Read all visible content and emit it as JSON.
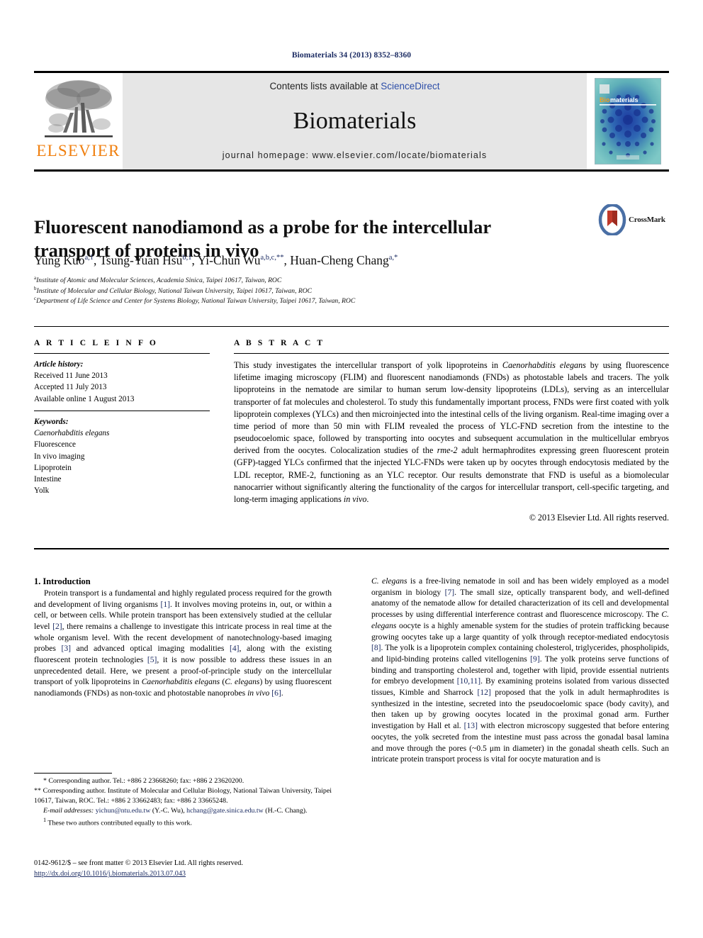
{
  "running_head": "Biomaterials 34 (2013) 8352–8360",
  "masthead": {
    "contents_prefix": "Contents lists available at ",
    "sciencedirect": "ScienceDirect",
    "journal_name": "Biomaterials",
    "homepage": "journal homepage: www.elsevier.com/locate/biomaterials",
    "publisher_logo_text": "ELSEVIER",
    "cover_title_bio": "Bio",
    "cover_title_materials": "materials",
    "colors": {
      "elsevier_orange": "#f08010",
      "sciencedirect_blue": "#2d4ea8",
      "band_gray": "#e6e6e6",
      "running_head_navy": "#1c2c63",
      "cover_teal": "#63b5b8",
      "cover_blue": "#1c3b9e"
    }
  },
  "article": {
    "title": "Fluorescent nanodiamond as a probe for the intercellular transport of proteins in vivo",
    "crossmark_label": "CrossMark",
    "authors": [
      {
        "name": "Yung Kuo",
        "marks": "a,1",
        "sep": ", "
      },
      {
        "name": "Tsung-Yuan Hsu",
        "marks": "b,1",
        "sep": ", "
      },
      {
        "name": "Yi-Chun Wu",
        "marks": "a,b,c,**",
        "sep": ", "
      },
      {
        "name": "Huan-Cheng Chang",
        "marks": "a,*",
        "sep": ""
      }
    ],
    "affiliations": [
      {
        "mark": "a",
        "text": "Institute of Atomic and Molecular Sciences, Academia Sinica, Taipei 10617, Taiwan, ROC"
      },
      {
        "mark": "b",
        "text": "Institute of Molecular and Cellular Biology, National Taiwan University, Taipei 10617, Taiwan, ROC"
      },
      {
        "mark": "c",
        "text": "Department of Life Science and Center for Systems Biology, National Taiwan University, Taipei 10617, Taiwan, ROC"
      }
    ]
  },
  "article_info": {
    "heading": "A R T I C L E   I N F O",
    "history_label": "Article history:",
    "history": [
      "Received 11 June 2013",
      "Accepted 11 July 2013",
      "Available online 1 August 2013"
    ],
    "keywords_label": "Keywords:",
    "keywords": [
      "Caenorhabditis elegans",
      "Fluorescence",
      "In vivo imaging",
      "Lipoprotein",
      "Intestine",
      "Yolk"
    ]
  },
  "abstract": {
    "heading": "A B S T R A C T",
    "paragraphs": [
      "This study investigates the intercellular transport of yolk lipoproteins in Caenorhabditis elegans by using fluorescence lifetime imaging microscopy (FLIM) and fluorescent nanodiamonds (FNDs) as photostable labels and tracers. The yolk lipoproteins in the nematode are similar to human serum low-density lipoproteins (LDLs), serving as an intercellular transporter of fat molecules and cholesterol. To study this fundamentally important process, FNDs were first coated with yolk lipoprotein complexes (YLCs) and then microinjected into the intestinal cells of the living organism. Real-time imaging over a time period of more than 50 min with FLIM revealed the process of YLC-FND secretion from the intestine to the pseudocoelomic space, followed by transporting into oocytes and subsequent accumulation in the multicellular embryos derived from the oocytes. Colocalization studies of the rme-2 adult hermaphrodites expressing green fluorescent protein (GFP)-tagged YLCs confirmed that the injected YLC-FNDs were taken up by oocytes through endocytosis mediated by the LDL receptor, RME-2, functioning as an YLC receptor. Our results demonstrate that FND is useful as a biomolecular nanocarrier without significantly altering the functionality of the cargos for intercellular transport, cell-specific targeting, and long-term imaging applications in vivo."
    ],
    "copyright": "© 2013 Elsevier Ltd. All rights reserved."
  },
  "body": {
    "section_number_title": "1.  Introduction",
    "left_paragraphs": [
      "Protein transport is a fundamental and highly regulated process required for the growth and development of living organisms [1]. It involves moving proteins in, out, or within a cell, or between cells. While protein transport has been extensively studied at the cellular level [2], there remains a challenge to investigate this intricate process in real time at the whole organism level. With the recent development of nanotechnology-based imaging probes [3] and advanced optical imaging modalities [4], along with the existing fluorescent protein technologies [5], it is now possible to address these issues in an unprecedented detail. Here, we present a proof-of-principle study on the intercellular transport of yolk lipoproteins in Caenorhabditis elegans (C. elegans) by using fluorescent nanodiamonds (FNDs) as non-toxic and photostable nanoprobes in vivo [6]."
    ],
    "right_paragraphs": [
      "C. elegans is a free-living nematode in soil and has been widely employed as a model organism in biology [7]. The small size, optically transparent body, and well-defined anatomy of the nematode allow for detailed characterization of its cell and developmental processes by using differential interference contrast and fluorescence microscopy. The C. elegans oocyte is a highly amenable system for the studies of protein trafficking because growing oocytes take up a large quantity of yolk through receptor-mediated endocytosis [8]. The yolk is a lipoprotein complex containing cholesterol, triglycerides, phospholipids, and lipid-binding proteins called vitellogenins [9]. The yolk proteins serve functions of binding and transporting cholesterol and, together with lipid, provide essential nutrients for embryo development [10,11]. By examining proteins isolated from various dissected tissues, Kimble and Sharrock [12] proposed that the yolk in adult hermaphrodites is synthesized in the intestine, secreted into the pseudocoelomic space (body cavity), and then taken up by growing oocytes located in the proximal gonad arm. Further investigation by Hall et al. [13] with electron microscopy suggested that before entering oocytes, the yolk secreted from the intestine must pass across the gonadal basal lamina and move through the pores (~0.5 μm in diameter) in the gonadal sheath cells. Such an intricate protein transport process is vital for oocyte maturation and is"
    ]
  },
  "footnotes": {
    "line1": "* Corresponding author. Tel.: +886 2 23668260; fax: +886 2 23620200.",
    "line2": "** Corresponding author. Institute of Molecular and Cellular Biology, National Taiwan University, Taipei 10617, Taiwan, ROC. Tel.: +886 2 33662483; fax: +886 2 33665248.",
    "email_label": "E-mail addresses:",
    "email1": "yichun@ntu.edu.tw",
    "email1_owner": "(Y.-C. Wu),",
    "email2": "hchang@gate.sinica.edu.tw",
    "email2_owner": "(H.-C. Chang).",
    "line3_mark": "1",
    "line3": "These two authors contributed equally to this work."
  },
  "imprint": {
    "line1": "0142-9612/$ – see front matter © 2013 Elsevier Ltd. All rights reserved.",
    "doi": "http://dx.doi.org/10.1016/j.biomaterials.2013.07.043"
  }
}
